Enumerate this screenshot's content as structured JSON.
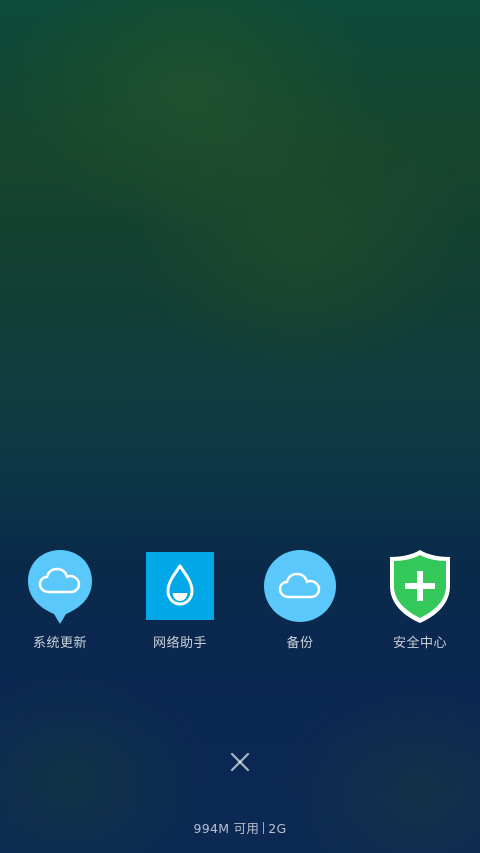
{
  "apps": [
    {
      "label": "系统更新",
      "icon": "cloud-balloon-icon",
      "color": "#5ac8fa"
    },
    {
      "label": "网络助手",
      "icon": "water-drop-icon",
      "color": "#00a8e8"
    },
    {
      "label": "备份",
      "icon": "cloud-icon",
      "color": "#5ac8fa"
    },
    {
      "label": "安全中心",
      "icon": "plus-shield-icon",
      "color": "#34c759"
    }
  ],
  "close_icon": "close-icon",
  "memory": {
    "available": "994M 可用",
    "total": "2G"
  }
}
